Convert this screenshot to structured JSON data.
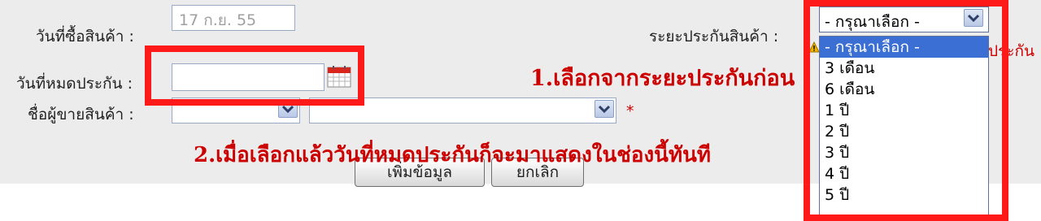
{
  "form": {
    "purchase_date_label": "วันที่ซื้อสินค้า :",
    "purchase_date_value": "17 ก.ย. 55",
    "warranty_period_label": "ระยะประกันสินค้า :",
    "expire_date_label": "วันที่หมดประกัน :",
    "expire_date_value": "",
    "seller_label": "ชื่อผู้ขายสินค้า :",
    "required_mark": "*",
    "warranty_trailing_text": "ประกัน"
  },
  "warranty_select": {
    "selected": "- กรุณาเลือก -",
    "options": [
      "- กรุณาเลือก -",
      "3 เดือน",
      "6 เดือน",
      "1 ปี",
      "2 ปี",
      "3 ปี",
      "4 ปี",
      "5 ปี"
    ]
  },
  "buttons": {
    "add": "เพิ่มข้อมูล",
    "cancel": "ยกเลิก"
  },
  "annotations": {
    "step1": "1.เลือกจากระยะประกันก่อน",
    "step2": "2.เมื่อเลือกแล้ววันที่หมดประกันก็จะมาแสดงในช่องนี้ทันที"
  },
  "icons": {
    "calendar": "calendar-icon",
    "dropdown": "chevron-down-icon",
    "warning": "warning-icon"
  },
  "colors": {
    "annotation_red": "#cc0000",
    "highlight_box": "#ff1a1a",
    "selected_option": "#3b6fd4"
  }
}
